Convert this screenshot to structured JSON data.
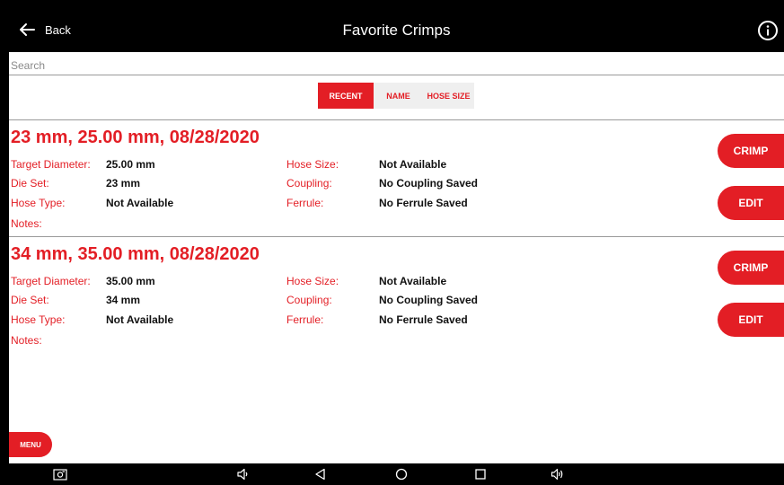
{
  "header": {
    "back_label": "Back",
    "title": "Favorite Crimps"
  },
  "search": {
    "placeholder": "Search",
    "value": ""
  },
  "tabs": [
    {
      "label": "RECENT",
      "active": true
    },
    {
      "label": "NAME",
      "active": false
    },
    {
      "label": "HOSE SIZE",
      "active": false
    }
  ],
  "records": [
    {
      "title": "23 mm, 25.00 mm, 08/28/2020",
      "target_diameter_label": "Target Diameter:",
      "target_diameter": "25.00 mm",
      "die_set_label": "Die Set:",
      "die_set": "23 mm",
      "hose_type_label": "Hose Type:",
      "hose_type": "Not Available",
      "notes_label": "Notes:",
      "hose_size_label": "Hose Size:",
      "hose_size": "Not Available",
      "coupling_label": "Coupling:",
      "coupling": "No Coupling Saved",
      "ferrule_label": "Ferrule:",
      "ferrule": "No Ferrule Saved",
      "crimp_label": "CRIMP",
      "edit_label": "EDIT"
    },
    {
      "title": "34 mm, 35.00 mm, 08/28/2020",
      "target_diameter_label": "Target Diameter:",
      "target_diameter": "35.00 mm",
      "die_set_label": "Die Set:",
      "die_set": "34 mm",
      "hose_type_label": "Hose Type:",
      "hose_type": "Not Available",
      "notes_label": "Notes:",
      "hose_size_label": "Hose Size:",
      "hose_size": "Not Available",
      "coupling_label": "Coupling:",
      "coupling": "No Coupling Saved",
      "ferrule_label": "Ferrule:",
      "ferrule": "No Ferrule Saved",
      "crimp_label": "CRIMP",
      "edit_label": "EDIT"
    }
  ],
  "menu_label": "MENU",
  "navbar_icons": [
    "screenshot-icon",
    "volume-down-icon",
    "back-triangle-icon",
    "home-circle-icon",
    "recents-square-icon",
    "volume-up-icon"
  ],
  "colors": {
    "accent": "#e31e25",
    "header_bg": "#000000",
    "tab_bg": "#efefef"
  }
}
